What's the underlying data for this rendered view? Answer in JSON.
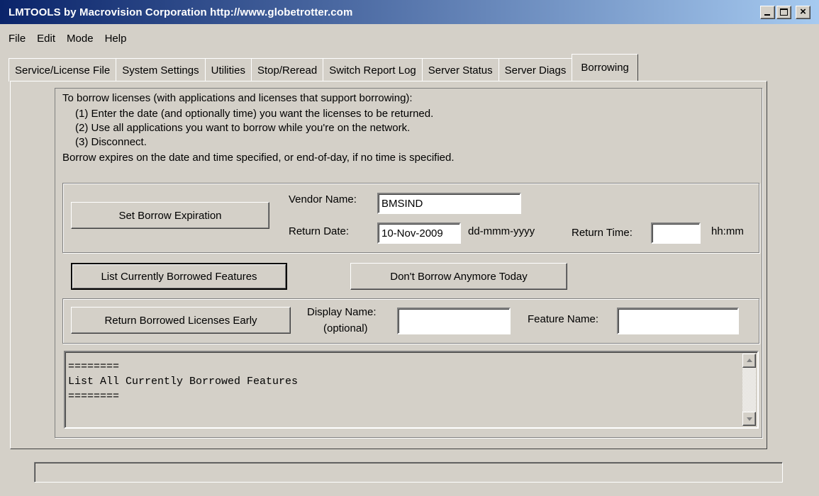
{
  "window": {
    "title": "LMTOOLS by Macrovision Corporation http://www.globetrotter.com"
  },
  "menu": [
    "File",
    "Edit",
    "Mode",
    "Help"
  ],
  "tabs": [
    {
      "label": "Service/License File"
    },
    {
      "label": "System Settings"
    },
    {
      "label": "Utilities"
    },
    {
      "label": "Stop/Reread"
    },
    {
      "label": "Switch Report Log"
    },
    {
      "label": "Server Status"
    },
    {
      "label": "Server Diags"
    },
    {
      "label": "Borrowing",
      "active": true
    }
  ],
  "instructions": {
    "line0": "To borrow licenses (with applications and licenses that support borrowing):",
    "line1": "(1) Enter the date (and optionally time) you want the licenses to be returned.",
    "line2": "(2) Use all applications you want to borrow while you're on the network.",
    "line3": "(3) Disconnect.",
    "line4": "Borrow expires on the date and time specified, or end-of-day, if no time is specified."
  },
  "expiration": {
    "set_button": "Set Borrow Expiration",
    "vendor_label": "Vendor Name:",
    "vendor_value": "BMSIND",
    "return_date_label": "Return Date:",
    "return_date_value": "10-Nov-2009",
    "date_format": "dd-mmm-yyyy",
    "return_time_label": "Return Time:",
    "return_time_value": "",
    "time_format": "hh:mm"
  },
  "actions": {
    "list_button": "List Currently Borrowed Features",
    "dont_borrow_button": "Don't Borrow Anymore Today"
  },
  "return_early": {
    "button": "Return Borrowed Licenses Early",
    "display_label_1": "Display Name:",
    "display_label_2": "(optional)",
    "display_value": "",
    "feature_label": "Feature Name:",
    "feature_value": ""
  },
  "output": {
    "text": "========\nList All Currently Borrowed Features\n========"
  },
  "status": {
    "text": ""
  }
}
